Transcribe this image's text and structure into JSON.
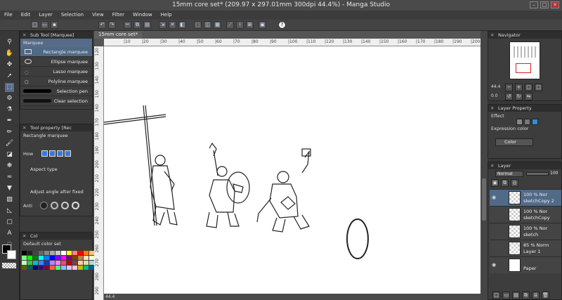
{
  "window": {
    "title": "15mm core set* (209.97 x 297.01mm 300dpi 44.4%) - Manga Studio",
    "min": "–",
    "max": "□",
    "close": "✕"
  },
  "menu": [
    "File",
    "Edit",
    "Layer",
    "Selection",
    "View",
    "Filter",
    "Window",
    "Help"
  ],
  "toolbar_icons": [
    "new-file-icon",
    "open-icon",
    "save-icon",
    "undo-icon",
    "redo-icon",
    "cut-icon",
    "copy-icon",
    "paste-icon",
    "transform-icon",
    "clear-icon",
    "fill-icon",
    "deselect-icon",
    "invert-icon",
    "grid-icon",
    "select-all-icon",
    "snap-ruler-icon",
    "snap-special-icon",
    "snap-grid-icon",
    "layer-icon",
    "help-icon"
  ],
  "sub_tool": {
    "header": "Sub Tool [Marquee]",
    "group": "Marquee",
    "items": [
      "Rectangle marquee",
      "Ellipse marquee",
      "Lasso marquee",
      "Polyline marquee",
      "Selection pen",
      "Clear selection"
    ]
  },
  "tool_property": {
    "header": "Tool property [Rec",
    "tool_name": "Rectangle marquee",
    "how_label": "How",
    "aspect_label": "Aspect type",
    "adjust_label": "Adjust angle after fixed",
    "aa_label": "Anti"
  },
  "color_set": {
    "header": "Col",
    "set_name": "Default color set",
    "swatches": [
      "#000000",
      "#222222",
      "#444444",
      "#666666",
      "#888888",
      "#aaaaaa",
      "#cccccc",
      "#ffffff",
      "#ffff00",
      "#ff8080",
      "#ff0000",
      "#ff8000",
      "#ffc080",
      "#80ff80",
      "#00ff00",
      "#008000",
      "#00ffff",
      "#0080ff",
      "#0000ff",
      "#8000ff",
      "#ff00ff",
      "#800080",
      "#804000",
      "#c08040",
      "#ffe0c0",
      "#ffffc0",
      "#c0ffc0",
      "#40c040",
      "#00c0c0",
      "#4080ff",
      "#0040c0",
      "#c080ff",
      "#ff80ff",
      "#ff4080",
      "#c00000",
      "#804040",
      "#ffd0a0",
      "#e0e0a0",
      "#a0e0e0",
      "#606000",
      "#006060",
      "#000080",
      "#400080",
      "#800040",
      "#ff6040",
      "#40ff80",
      "#80c0ff",
      "#e0c0ff",
      "#ffc0e0",
      "#c0c000",
      "#00c080",
      "#0060a0"
    ]
  },
  "document": {
    "tab": "15mm core set*",
    "h_ruler": [
      "|10",
      "|20",
      "|30",
      "|40",
      "|50",
      "|60",
      "|70",
      "|80",
      "|90",
      "|100",
      "|110",
      "|120",
      "|130",
      "|140",
      "|150",
      "|160",
      "|170",
      "|180",
      "|190",
      "|200"
    ],
    "v_ruler": [
      "120",
      "130",
      "140",
      "150",
      "160",
      "170",
      "180",
      "190",
      "200",
      "210",
      "220",
      "230",
      "240",
      "250",
      "260",
      "270",
      "280",
      "290"
    ],
    "zoom": "44.4"
  },
  "navigator": {
    "header": "Navigator",
    "zoom": "44.4",
    "angle": "0.0"
  },
  "layer_property": {
    "header": "Layer Property",
    "effect_label": "Effect",
    "expression_label": "Expression color",
    "expression_value": "Color"
  },
  "layer_panel": {
    "header": "Layer",
    "blend": "Normal",
    "opacity": "100",
    "layers": [
      {
        "line1": "100 %  Nor",
        "line2": "sketchCopy 2",
        "selected": true
      },
      {
        "line1": "100 %  Nor",
        "line2": "sketchCopy",
        "selected": false
      },
      {
        "line1": "100 %  Nor",
        "line2": "sketch",
        "selected": false
      },
      {
        "line1": "85 %  Norm",
        "line2": "Layer 1",
        "selected": false
      },
      {
        "line1": "",
        "line2": "Paper",
        "selected": false
      }
    ]
  }
}
